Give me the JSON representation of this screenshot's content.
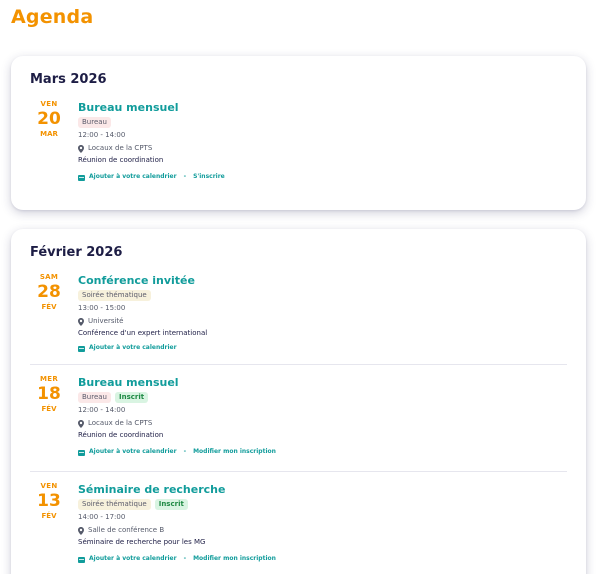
{
  "page": {
    "title": "Agenda"
  },
  "months": [
    {
      "title": "Mars 2026",
      "events": [
        {
          "dow": "VEN",
          "day": "20",
          "month": "MAR",
          "title": "Bureau mensuel",
          "tags": [
            "Bureau"
          ],
          "registered_badge": "",
          "time": "12:00 - 14:00",
          "location": "Locaux de la CPTS",
          "description": "Réunion de coordination",
          "actions": [
            "Ajouter à votre calendrier",
            "S'inscrire"
          ]
        }
      ]
    },
    {
      "title": "Février 2026",
      "events": [
        {
          "dow": "SAM",
          "day": "28",
          "month": "FÉV",
          "title": "Conférence invitée",
          "tags": [
            "Soirée thématique"
          ],
          "registered_badge": "",
          "time": "13:00 - 15:00",
          "location": "Université",
          "description": "Conférence d'un expert international",
          "actions": [
            "Ajouter à votre calendrier"
          ]
        },
        {
          "dow": "MER",
          "day": "18",
          "month": "FÉV",
          "title": "Bureau mensuel",
          "tags": [
            "Bureau"
          ],
          "registered_badge": "Inscrit",
          "time": "12:00 - 14:00",
          "location": "Locaux de la CPTS",
          "description": "Réunion de coordination",
          "actions": [
            "Ajouter à votre calendrier",
            "Modifier mon inscription"
          ]
        },
        {
          "dow": "VEN",
          "day": "13",
          "month": "FÉV",
          "title": "Séminaire de recherche",
          "tags": [
            "Soirée thématique"
          ],
          "registered_badge": "Inscrit",
          "time": "14:00 - 17:00",
          "location": "Salle de conférence B",
          "description": "Séminaire de recherche pour les MG",
          "actions": [
            "Ajouter à votre calendrier",
            "Modifier mon inscription"
          ]
        }
      ]
    }
  ],
  "colors": {
    "accent": "#f39200",
    "title": "#119c9b",
    "heading": "#1d1d45"
  },
  "icons": {
    "location": "map-pin-icon",
    "calendar": "calendar-icon"
  }
}
